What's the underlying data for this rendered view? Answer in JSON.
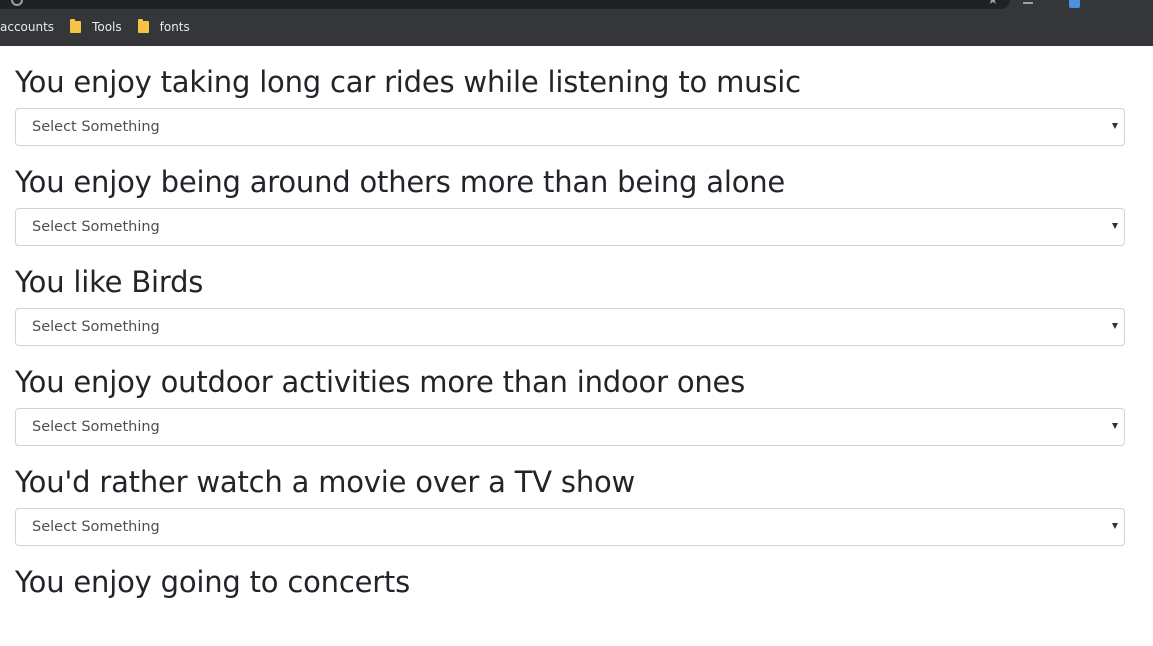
{
  "browser": {
    "bookmarks": [
      "accounts",
      "Tools",
      "fonts"
    ]
  },
  "form": {
    "questions": [
      {
        "label": "You enjoy taking long car rides while listening to music",
        "select_value": "Select Something"
      },
      {
        "label": "You enjoy being around others more than being alone",
        "select_value": "Select Something"
      },
      {
        "label": "You like Birds",
        "select_value": "Select Something"
      },
      {
        "label": "You enjoy outdoor activities more than indoor ones",
        "select_value": "Select Something"
      },
      {
        "label": "You'd rather watch a movie over a TV show",
        "select_value": "Select Something"
      },
      {
        "label": "You enjoy going to concerts",
        "select_value": ""
      }
    ]
  }
}
